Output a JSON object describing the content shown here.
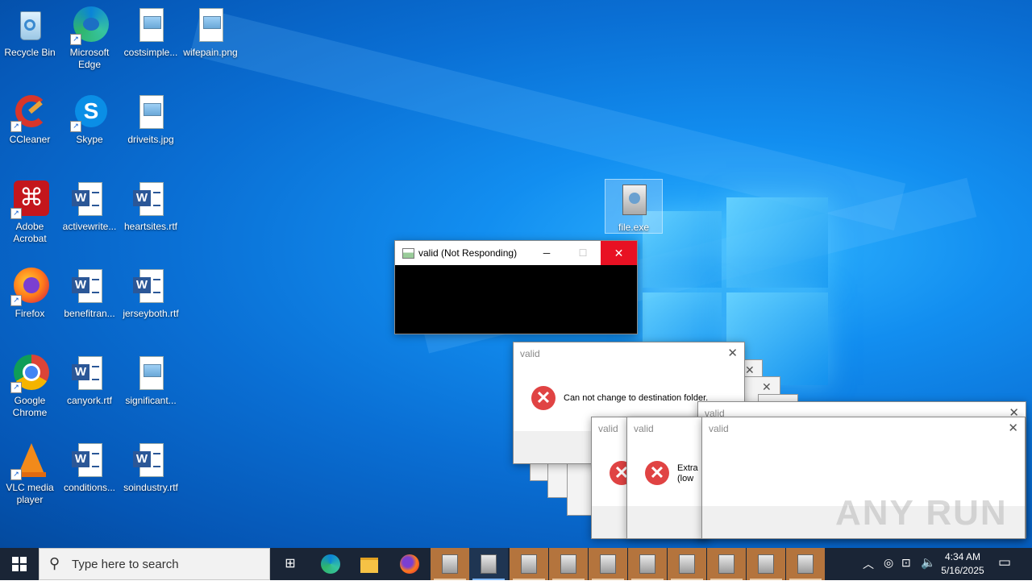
{
  "desktop": {
    "icons": [
      {
        "label": "Recycle Bin",
        "icon": "recycle-bin-icon"
      },
      {
        "label": "Microsoft Edge",
        "icon": "edge-icon"
      },
      {
        "label": "costsimple...",
        "icon": "image-file-icon"
      },
      {
        "label": "wifepain.png",
        "icon": "image-file-icon"
      },
      {
        "label": "CCleaner",
        "icon": "ccleaner-icon"
      },
      {
        "label": "Skype",
        "icon": "skype-icon"
      },
      {
        "label": "driveits.jpg",
        "icon": "image-file-icon"
      },
      {
        "label": "Adobe Acrobat",
        "icon": "acrobat-icon"
      },
      {
        "label": "activewrite...",
        "icon": "word-file-icon"
      },
      {
        "label": "heartsites.rtf",
        "icon": "word-file-icon"
      },
      {
        "label": "Firefox",
        "icon": "firefox-icon"
      },
      {
        "label": "benefitran...",
        "icon": "word-file-icon"
      },
      {
        "label": "jerseyboth.rtf",
        "icon": "word-file-icon"
      },
      {
        "label": "Google Chrome",
        "icon": "chrome-icon"
      },
      {
        "label": "canyork.rtf",
        "icon": "word-file-icon"
      },
      {
        "label": "significant...",
        "icon": "image-file-icon"
      },
      {
        "label": "VLC media player",
        "icon": "vlc-icon"
      },
      {
        "label": "conditions...",
        "icon": "word-file-icon"
      },
      {
        "label": "soindustry.rtf",
        "icon": "word-file-icon"
      },
      {
        "label": "file.exe",
        "icon": "installer-icon"
      }
    ]
  },
  "not_responding_window": {
    "title": "valid (Not Responding)",
    "minimize": "─",
    "maximize": "☐",
    "close": "✕"
  },
  "dialogs": {
    "main": {
      "title": "valid",
      "message": "Can not change to destination folder.",
      "close": "✕"
    },
    "second": {
      "title": "valid",
      "message": "Extra (low",
      "close": "✕"
    },
    "third": {
      "title": "valid",
      "close": "✕"
    },
    "behind": {
      "title": "valid",
      "close": "✕"
    }
  },
  "watermark": {
    "text": "ANY RUN"
  },
  "taskbar": {
    "start_icon": "windows-start-icon",
    "search_placeholder": "Type here to search",
    "time": "4:34 AM",
    "date": "5/16/2025",
    "accent": "#b4743d"
  },
  "colors": {
    "taskbar": "#1a2536",
    "close_red": "#e81123",
    "error_red": "#e04343"
  }
}
